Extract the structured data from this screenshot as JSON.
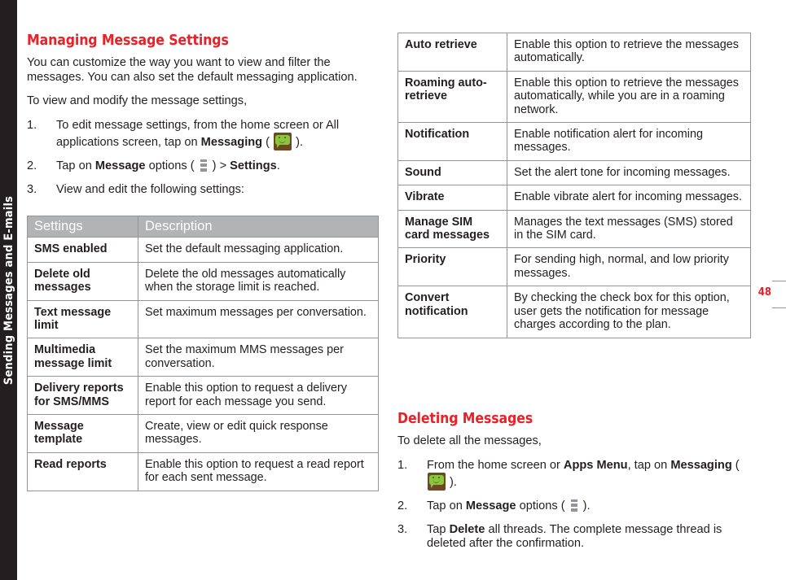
{
  "chapter_tab": {
    "label": "Sending Messages and E-mails"
  },
  "page_number": "48",
  "left": {
    "heading": "Managing Message Settings",
    "intro_paragraph": "You can customize the way you want to view and filter the messages. You can also set the default messaging application.",
    "lead_in": "To view and modify the message settings,",
    "steps": [
      {
        "num": "1.",
        "text_before": "To edit message settings, from the home screen or All applications screen, tap on ",
        "bold1": "Messaging",
        "text_mid": " ( ",
        "icon": "messaging-app-icon",
        "text_after": " )."
      },
      {
        "num": "2.",
        "text_before": "Tap on ",
        "bold1": "Message",
        "text_mid": " options ( ",
        "icon": "overflow-menu-icon",
        "text_after": " ) > ",
        "bold2": "Settings",
        "text_end": "."
      },
      {
        "num": "3.",
        "text_before": "View and edit the following settings:"
      }
    ],
    "table": {
      "headers": [
        "Settings",
        "Description"
      ],
      "rows": [
        [
          "SMS enabled",
          "Set the default messaging application."
        ],
        [
          "Delete old messages",
          "Delete the old messages automatically when the storage limit is reached."
        ],
        [
          "Text message limit",
          "Set maximum messages per conversation."
        ],
        [
          "Multimedia message limit",
          "Set the maximum MMS messages per conversation."
        ],
        [
          "Delivery reports for SMS/MMS",
          "Enable this option to request a delivery report for each message you send."
        ],
        [
          "Message template",
          "Create, view or edit quick response messages."
        ],
        [
          "Read reports",
          "Enable this option to request a read report for each sent message."
        ]
      ]
    }
  },
  "right": {
    "table": {
      "rows": [
        [
          "Auto retrieve",
          "Enable this option to retrieve the messages automatically."
        ],
        [
          "Roaming auto-retrieve",
          "Enable this option to retrieve the messages automatically, while you are in a roaming network."
        ],
        [
          "Notification",
          "Enable notification alert for incoming messages."
        ],
        [
          "Sound",
          "Set the alert tone for incoming messages."
        ],
        [
          "Vibrate",
          "Enable vibrate alert for incoming messages."
        ],
        [
          "Manage SIM card messages",
          "Manages the text messages (SMS) stored in the SIM card."
        ],
        [
          "Priority",
          "For sending high, normal, and low priority messages."
        ],
        [
          "Convert notification",
          "By checking the check box for this option, user gets the notification for message charges according to the plan."
        ]
      ]
    },
    "heading": "Deleting Messages",
    "lead_in": "To delete all the messages,",
    "steps": [
      {
        "num": "1.",
        "text_before": "From the home screen or ",
        "bold1": "Apps Menu",
        "text_mid": ", tap on ",
        "bold2": "Messaging",
        "text_after": " ( ",
        "icon": "messaging-app-icon",
        "text_end": " )."
      },
      {
        "num": "2.",
        "text_before": "Tap on ",
        "bold1": "Message",
        "text_mid": " options ( ",
        "icon": "overflow-menu-icon",
        "text_after": " )."
      },
      {
        "num": "3.",
        "text_before": "Tap ",
        "bold1": "Delete",
        "text_mid": " all threads. The complete message thread is deleted after the confirmation."
      }
    ]
  },
  "colors": {
    "accent_red": "#ec2027",
    "tab_black": "#231f20",
    "table_header_gray": "#b1b3b5",
    "table_border_gray": "#939598",
    "icon_green": "#8cc63e",
    "icon_brown": "#6b4a23"
  }
}
